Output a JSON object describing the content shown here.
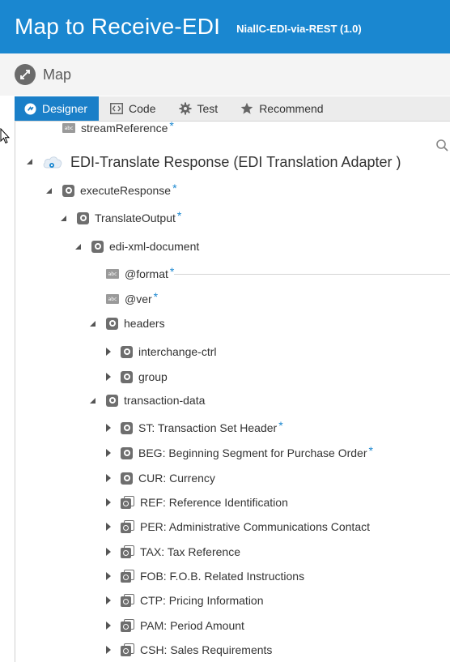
{
  "header": {
    "title": "Map to Receive-EDI",
    "subtitle": "NiallC-EDI-via-REST (1.0)"
  },
  "map_row": {
    "label": "Map"
  },
  "toolbar": {
    "tabs": [
      {
        "label": "Designer",
        "icon": "designer-icon",
        "active": true
      },
      {
        "label": "Code",
        "icon": "code-icon",
        "active": false
      },
      {
        "label": "Test",
        "icon": "gear-icon",
        "active": false
      },
      {
        "label": "Recommend",
        "icon": "star-icon",
        "active": false
      }
    ]
  },
  "tree": {
    "stream_reference": "streamReference",
    "root": "EDI-Translate Response (EDI Translation Adapter )",
    "execute_response": "executeResponse",
    "translate_output": "TranslateOutput",
    "edi_xml_document": "edi-xml-document",
    "format_attr": "@format",
    "ver_attr": "@ver",
    "headers": "headers",
    "interchange_ctrl": "interchange-ctrl",
    "group": "group",
    "transaction_data": "transaction-data",
    "segments": [
      {
        "label": "ST: Transaction Set Header",
        "required": true,
        "multi": false
      },
      {
        "label": "BEG: Beginning Segment for Purchase Order",
        "required": true,
        "multi": false
      },
      {
        "label": "CUR: Currency",
        "required": false,
        "multi": false
      },
      {
        "label": "REF: Reference Identification",
        "required": false,
        "multi": true
      },
      {
        "label": "PER: Administrative Communications Contact",
        "required": false,
        "multi": true
      },
      {
        "label": "TAX: Tax Reference",
        "required": false,
        "multi": true
      },
      {
        "label": "FOB: F.O.B. Related Instructions",
        "required": false,
        "multi": true
      },
      {
        "label": "CTP: Pricing Information",
        "required": false,
        "multi": true
      },
      {
        "label": "PAM: Period Amount",
        "required": false,
        "multi": true
      },
      {
        "label": "CSH: Sales Requirements",
        "required": false,
        "multi": true
      }
    ],
    "required_marker": "*",
    "abc_text": "abc"
  },
  "colors": {
    "header_bg": "#1a87d0",
    "active_tab": "#1a7fc8",
    "required": "#1a87d0"
  }
}
